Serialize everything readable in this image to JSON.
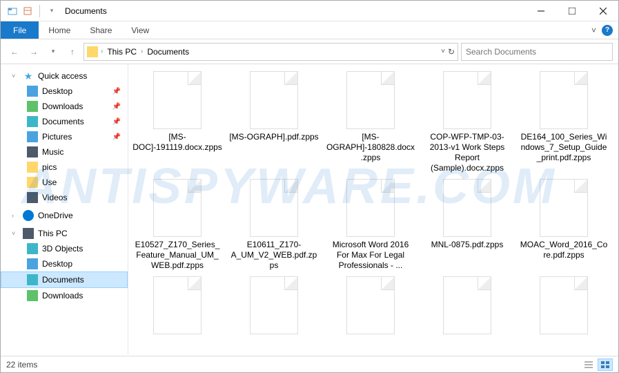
{
  "window": {
    "title": "Documents"
  },
  "ribbon": {
    "file": "File",
    "tabs": [
      "Home",
      "Share",
      "View"
    ]
  },
  "breadcrumb": {
    "items": [
      "This PC",
      "Documents"
    ]
  },
  "search": {
    "placeholder": "Search Documents"
  },
  "nav": {
    "quick_access": {
      "label": "Quick access",
      "items": [
        {
          "label": "Desktop",
          "icon": "desktop",
          "pinned": true
        },
        {
          "label": "Downloads",
          "icon": "downloads",
          "pinned": true
        },
        {
          "label": "Documents",
          "icon": "documents",
          "pinned": true
        },
        {
          "label": "Pictures",
          "icon": "pictures",
          "pinned": true
        },
        {
          "label": "Music",
          "icon": "music",
          "pinned": false
        },
        {
          "label": "pics",
          "icon": "folder",
          "pinned": false
        },
        {
          "label": "Use",
          "icon": "folder",
          "pinned": false
        },
        {
          "label": "Videos",
          "icon": "videos",
          "pinned": false
        }
      ]
    },
    "onedrive": {
      "label": "OneDrive"
    },
    "this_pc": {
      "label": "This PC",
      "items": [
        {
          "label": "3D Objects"
        },
        {
          "label": "Desktop"
        },
        {
          "label": "Documents",
          "selected": true
        },
        {
          "label": "Downloads"
        }
      ]
    }
  },
  "files": [
    {
      "name": "[MS-DOC]-191119.docx.zpps"
    },
    {
      "name": "[MS-OGRAPH].pdf.zpps"
    },
    {
      "name": "[MS-OGRAPH]-180828.docx.zpps"
    },
    {
      "name": "COP-WFP-TMP-03-2013-v1 Work Steps Report (Sample).docx.zpps"
    },
    {
      "name": "DE164_100_Series_Windows_7_Setup_Guide_print.pdf.zpps"
    },
    {
      "name": "E10527_Z170_Series_Feature_Manual_UM_WEB.pdf.zpps"
    },
    {
      "name": "E10611_Z170-A_UM_V2_WEB.pdf.zpps"
    },
    {
      "name": "Microsoft Word 2016 For Max For Legal Professionals - ..."
    },
    {
      "name": "MNL-0875.pdf.zpps"
    },
    {
      "name": "MOAC_Word_2016_Core.pdf.zpps"
    },
    {
      "name": ""
    },
    {
      "name": ""
    },
    {
      "name": ""
    },
    {
      "name": ""
    },
    {
      "name": ""
    }
  ],
  "status": {
    "count_text": "22 items"
  },
  "watermark": "ANTISPYWARE.COM"
}
